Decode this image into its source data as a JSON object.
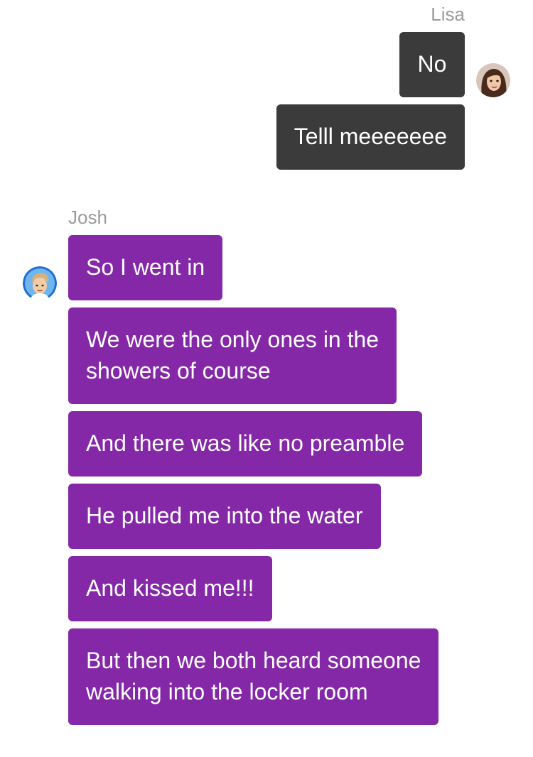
{
  "conversation": {
    "lisa": {
      "name": "Lisa",
      "bubble_color": "#3b3b3b",
      "avatar_icon": "female-avatar-icon",
      "messages": [
        "No",
        "Telll meeeeeee"
      ]
    },
    "josh": {
      "name": "Josh",
      "bubble_color": "#8428a8",
      "avatar_icon": "male-avatar-icon",
      "messages": [
        "So I went in",
        "We were the only ones in the",
        "showers of course",
        "And there was like no preamble",
        "He pulled me into the water",
        "And kissed me!!!",
        "But then we both heard someone",
        "walking into the locker room"
      ]
    }
  }
}
